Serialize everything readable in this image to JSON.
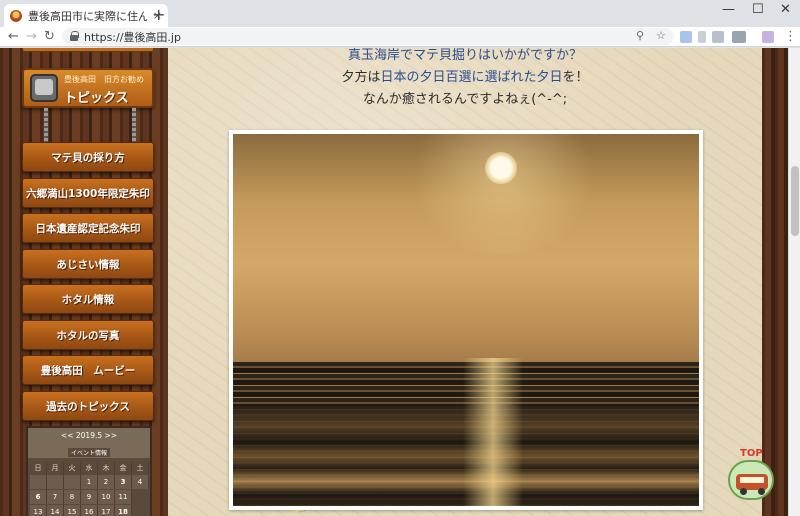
{
  "browser": {
    "tab_title": "豊後高田市に実際に住んでみた",
    "tab_close": "×",
    "new_tab": "+",
    "url": "https://豊後高田.jp",
    "window_controls": {
      "minimize": "—",
      "maximize": "☐",
      "close": "✕"
    },
    "nav": {
      "back": "←",
      "forward": "→",
      "reload": "↻"
    },
    "icons": [
      "lock-icon",
      "zoom-icon",
      "star-icon",
      "menu-icon"
    ]
  },
  "sidebar": {
    "topics_sign": {
      "small": "豊後高田　旧方お勧め",
      "big": "トピックス"
    },
    "menu": [
      {
        "label": "マテ貝の採り方"
      },
      {
        "label": "六郷満山1300年限定朱印"
      },
      {
        "label": "日本遺産認定記念朱印"
      },
      {
        "label": "あじさい情報"
      },
      {
        "label": "ホタル情報"
      },
      {
        "label": "ホタルの写真"
      },
      {
        "label": "豊後高田　ムービー"
      },
      {
        "label": "過去のトピックス"
      }
    ],
    "calendar": {
      "month_label": "<< 2019.5 >>",
      "event_label": "イベント情報",
      "weekdays": [
        "日",
        "月",
        "火",
        "水",
        "木",
        "金",
        "土"
      ],
      "rows": [
        [
          "",
          "",
          "",
          "1",
          "2",
          "3",
          "4"
        ],
        [
          "5",
          "6",
          "7",
          "8",
          "9",
          "10",
          "11"
        ],
        [
          "12",
          "13",
          "14",
          "15",
          "16",
          "17",
          "18"
        ]
      ]
    }
  },
  "content": {
    "line1": "真玉海岸でマテ貝掘りはいかがですか？",
    "line2_pre": "夕方は",
    "line2_link": "日本の夕日百選に選ばれた夕日",
    "line2_post": "を！",
    "line3": "なんか癒されるんですよねぇ(^-^;",
    "photo_alt": "sunset over tidal flats"
  },
  "top_button": {
    "label": "TOP"
  },
  "colors": {
    "link": "#2a4d8f",
    "wood": "#5d3520",
    "sign": "#b05d17"
  }
}
